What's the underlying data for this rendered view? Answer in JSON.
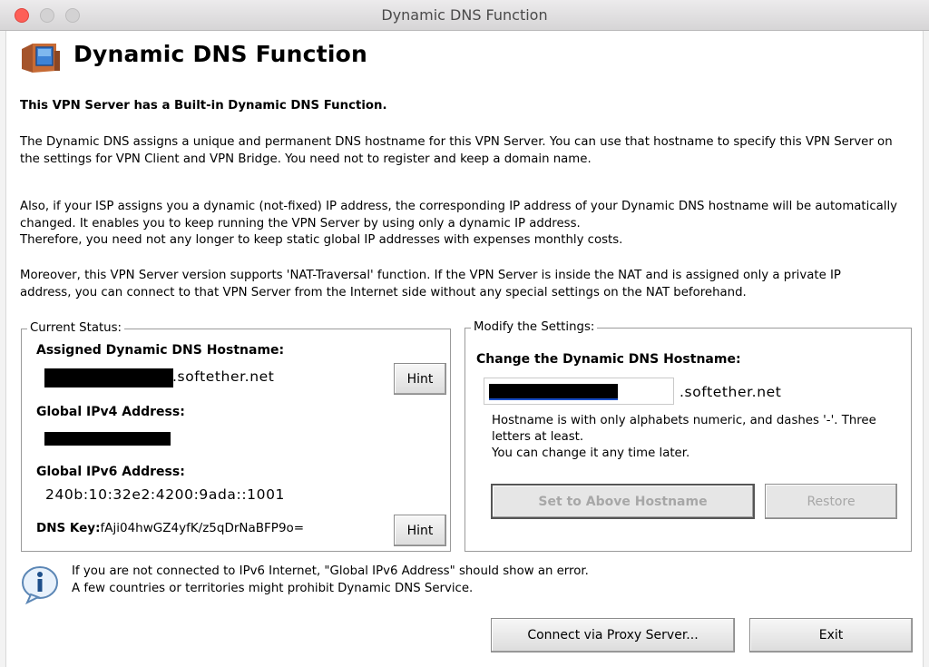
{
  "window": {
    "title": "Dynamic DNS Function"
  },
  "header": {
    "title": "Dynamic DNS Function",
    "icon": "computer-monitor-icon"
  },
  "intro": {
    "heading": "This VPN Server has a Built-in Dynamic DNS Function.",
    "para1": "The Dynamic DNS assigns a unique and permanent DNS hostname for this VPN Server. You can use that hostname to specify this VPN Server on\nthe settings for VPN Client and VPN Bridge. You need not to register and keep a domain name.",
    "para2": "Also, if your ISP assigns you a dynamic (not-fixed) IP address, the corresponding IP address of your Dynamic DNS hostname will be automatically\nchanged. It enables you to keep running the VPN Server by using only a dynamic IP address.\nTherefore, you need not any longer to keep static global IP addresses with expenses monthly costs.",
    "para3": "Moreover, this VPN Server version supports 'NAT-Traversal' function. If the VPN Server is inside the NAT and is assigned only a private IP\naddress, you can connect to that VPN Server from the Internet side without any special settings on the NAT beforehand."
  },
  "current_status": {
    "group_label": "Current Status:",
    "hostname_label": "Assigned Dynamic DNS Hostname:",
    "hostname_suffix": ".softether.net",
    "hint_button": "Hint",
    "ipv4_label": "Global IPv4 Address:",
    "ipv6_label": "Global IPv6 Address:",
    "ipv6_value": "240b:10:32e2:4200:9ada::1001",
    "dnskey_label": "DNS Key:",
    "dnskey_value": "fAji04hwGZ4yfK/z5qDrNaBFP9o=",
    "hint_button_2": "Hint"
  },
  "modify": {
    "group_label": "Modify the Settings:",
    "change_label": "Change the Dynamic DNS Hostname:",
    "hostname_suffix": ".softether.net",
    "hostname_note": "Hostname is with only alphabets numeric, and dashes '-'. Three\nletters at least.\nYou can change it any time later.",
    "set_button": "Set to Above Hostname",
    "restore_button": "Restore"
  },
  "footer": {
    "info_icon": "info-icon",
    "note": "If you are not connected to IPv6 Internet, \"Global IPv6 Address\" should show an error.\nA few countries or territories might prohibit Dynamic DNS Service.",
    "proxy_button": "Connect via Proxy Server...",
    "exit_button": "Exit"
  },
  "colors": {
    "close": "#fd5f57",
    "redaction": "#000000",
    "redaction_blue": "#1a4fc7"
  }
}
